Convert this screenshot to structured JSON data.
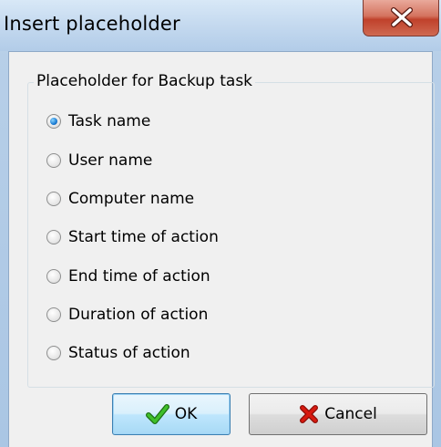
{
  "window": {
    "title": "Insert placeholder"
  },
  "titlebar": {
    "close_icon": "close-x-icon"
  },
  "group": {
    "title": "Placeholder for Backup task",
    "options": [
      {
        "label": "Task name",
        "checked": true
      },
      {
        "label": "User name",
        "checked": false
      },
      {
        "label": "Computer name",
        "checked": false
      },
      {
        "label": "Start time of action",
        "checked": false
      },
      {
        "label": "End time of action",
        "checked": false
      },
      {
        "label": "Duration of action",
        "checked": false
      },
      {
        "label": "Status of action",
        "checked": false
      }
    ]
  },
  "buttons": {
    "ok_label": "OK",
    "ok_icon": "green-checkmark-icon",
    "cancel_label": "Cancel",
    "cancel_icon": "red-x-icon"
  },
  "colors": {
    "ok_check": "#2c9e1e",
    "cancel_x": "#c8140c",
    "close_button": "#c0412b"
  }
}
